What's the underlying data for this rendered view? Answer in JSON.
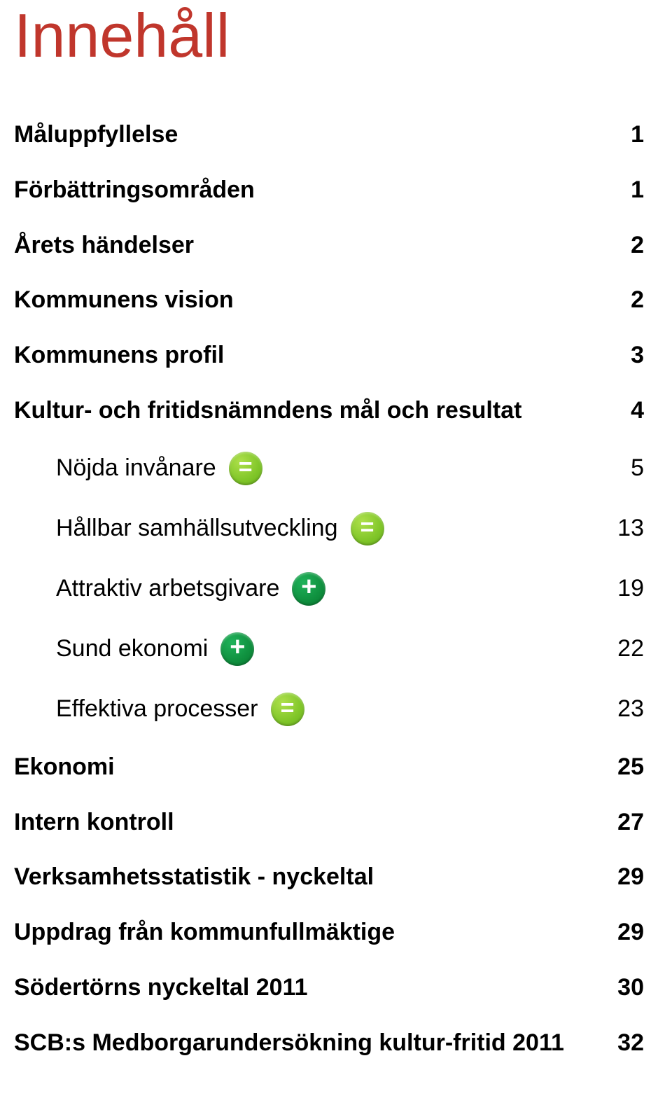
{
  "title": "Innehåll",
  "title_color": "#c0362c",
  "colors": {
    "badge_eq": "#7fc528",
    "badge_plus": "#0f8f3e"
  },
  "toc": [
    {
      "label": "Måluppfyllelse",
      "page": "1",
      "bold": true,
      "sub": false,
      "icon": null
    },
    {
      "label": "Förbättringsområden",
      "page": "1",
      "bold": true,
      "sub": false,
      "icon": null
    },
    {
      "label": "Årets händelser",
      "page": "2",
      "bold": true,
      "sub": false,
      "icon": null
    },
    {
      "label": "Kommunens vision",
      "page": "2",
      "bold": true,
      "sub": false,
      "icon": null
    },
    {
      "label": "Kommunens profil",
      "page": "3",
      "bold": true,
      "sub": false,
      "icon": null
    },
    {
      "label": "Kultur- och fritidsnämndens mål och resultat",
      "page": "4",
      "bold": true,
      "sub": false,
      "icon": null
    },
    {
      "label": "Nöjda invånare",
      "page": "5",
      "bold": false,
      "sub": true,
      "icon": "eq"
    },
    {
      "label": "Hållbar samhällsutveckling",
      "page": "13",
      "bold": false,
      "sub": true,
      "icon": "eq"
    },
    {
      "label": "Attraktiv arbetsgivare",
      "page": "19",
      "bold": false,
      "sub": true,
      "icon": "plus"
    },
    {
      "label": "Sund ekonomi",
      "page": "22",
      "bold": false,
      "sub": true,
      "icon": "plus"
    },
    {
      "label": "Effektiva processer",
      "page": "23",
      "bold": false,
      "sub": true,
      "icon": "eq"
    },
    {
      "label": "Ekonomi",
      "page": "25",
      "bold": true,
      "sub": false,
      "icon": null
    },
    {
      "label": "Intern kontroll",
      "page": "27",
      "bold": true,
      "sub": false,
      "icon": null
    },
    {
      "label": "Verksamhetsstatistik - nyckeltal",
      "page": "29",
      "bold": true,
      "sub": false,
      "icon": null
    },
    {
      "label": "Uppdrag från kommunfullmäktige",
      "page": "29",
      "bold": true,
      "sub": false,
      "icon": null
    },
    {
      "label": "Södertörns nyckeltal 2011",
      "page": "30",
      "bold": true,
      "sub": false,
      "icon": null
    },
    {
      "label": "SCB:s Medborgarundersökning kultur-fritid 2011",
      "page": "32",
      "bold": true,
      "sub": false,
      "icon": null
    }
  ]
}
